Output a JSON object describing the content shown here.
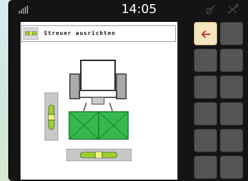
{
  "statusbar": {
    "time": "14:05",
    "icons": [
      "signal-icon",
      "gps-satellite-icon",
      "tools-icon"
    ]
  },
  "screen": {
    "title": "Streuer ausrichten",
    "title_icon": "spirit-level-icon"
  },
  "illustration": {
    "subject": "tractor-with-spreader",
    "vertical_level_icon": "vertical-spirit-level-icon",
    "horizontal_level_icon": "horizontal-spirit-level-icon"
  },
  "softkeys": {
    "back_icon": "back-arrow-icon",
    "accent_color": "#f6e6bf",
    "empty_button_color": "#555555"
  }
}
